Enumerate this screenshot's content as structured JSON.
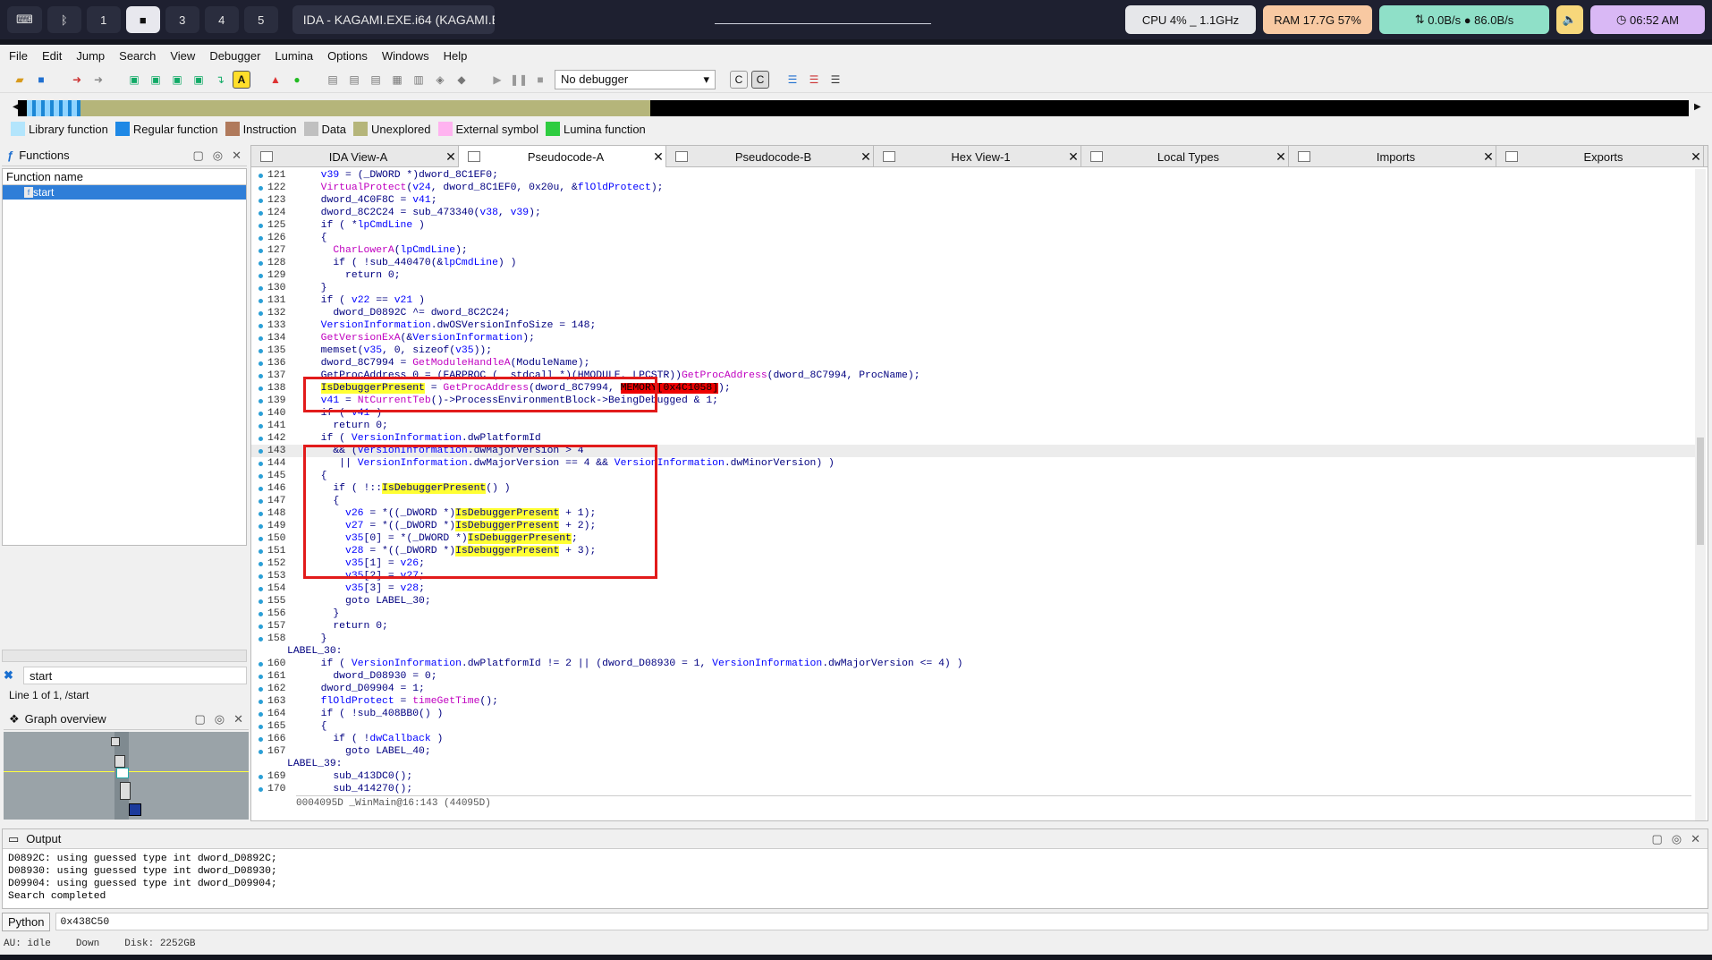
{
  "topbar": {
    "workspaces": [
      "1",
      "■",
      "3",
      "4",
      "5"
    ],
    "window_title": "IDA - KAGAMI.EXE.i64 (KAGAMI.EXE)",
    "cpu": "CPU 4% _ 1.1GHz",
    "ram": "RAM 17.7G 57%",
    "net": "0.0B/s ● 86.0B/s",
    "volume_icon": "speaker-icon",
    "clock": "06:52 AM",
    "colors": {
      "cpu": "#e6e7ea",
      "ram": "#f8c9a2",
      "net": "#8fe0c8",
      "vol": "#f7d77b",
      "clock": "#d9b8f5"
    }
  },
  "menu": [
    "File",
    "Edit",
    "Jump",
    "Search",
    "View",
    "Debugger",
    "Lumina",
    "Options",
    "Windows",
    "Help"
  ],
  "toolbar": {
    "debugger_select": "No debugger"
  },
  "legend": [
    {
      "label": "Library function",
      "color": "#b3e5fc"
    },
    {
      "label": "Regular function",
      "color": "#1e88e5"
    },
    {
      "label": "Instruction",
      "color": "#b07a5c"
    },
    {
      "label": "Data",
      "color": "#c0c0c0"
    },
    {
      "label": "Unexplored",
      "color": "#b5b57a"
    },
    {
      "label": "External symbol",
      "color": "#ffb3f0"
    },
    {
      "label": "Lumina function",
      "color": "#2ecc40"
    }
  ],
  "functions": {
    "title": "Functions",
    "header": "Function name",
    "items": [
      "start"
    ],
    "search_value": "start",
    "line_status": "Line 1 of 1, /start"
  },
  "graph": {
    "title": "Graph overview"
  },
  "tabs": [
    {
      "label": "IDA View-A",
      "active": false
    },
    {
      "label": "Pseudocode-A",
      "active": true
    },
    {
      "label": "Pseudocode-B",
      "active": false
    },
    {
      "label": "Hex View-1",
      "active": false
    },
    {
      "label": "Local Types",
      "active": false
    },
    {
      "label": "Imports",
      "active": false
    },
    {
      "label": "Exports",
      "active": false
    }
  ],
  "code_lines": [
    {
      "n": "121",
      "t": "  v39 = (_DWORD *)dword_8C1EF0;"
    },
    {
      "n": "122",
      "t": "  VirtualProtect(v24, dword_8C1EF0, 0x20u, &flOldProtect);"
    },
    {
      "n": "123",
      "t": "  dword_4C0F8C = v41;"
    },
    {
      "n": "124",
      "t": "  dword_8C2C24 = sub_473340(v38, v39);"
    },
    {
      "n": "125",
      "t": "  if ( *lpCmdLine )"
    },
    {
      "n": "126",
      "t": "  {"
    },
    {
      "n": "127",
      "t": "    CharLowerA(lpCmdLine);"
    },
    {
      "n": "128",
      "t": "    if ( !sub_440470(&lpCmdLine) )"
    },
    {
      "n": "129",
      "t": "      return 0;"
    },
    {
      "n": "130",
      "t": "  }"
    },
    {
      "n": "131",
      "t": "  if ( v22 == v21 )"
    },
    {
      "n": "132",
      "t": "    dword_D0892C ^= dword_8C2C24;"
    },
    {
      "n": "133",
      "t": "  VersionInformation.dwOSVersionInfoSize = 148;"
    },
    {
      "n": "134",
      "t": "  GetVersionExA(&VersionInformation);"
    },
    {
      "n": "135",
      "t": "  memset(v35, 0, sizeof(v35));"
    },
    {
      "n": "136",
      "t": "  dword_8C7994 = GetModuleHandleA(ModuleName);"
    },
    {
      "n": "137",
      "t": "  GetProcAddress_0 = (FARPROC (__stdcall *)(HMODULE, LPCSTR))GetProcAddress(dword_8C7994, ProcName);"
    },
    {
      "n": "138",
      "t": "  IsDebuggerPresent = GetProcAddress(dword_8C7994, MEMORY[0x4C1058]);"
    },
    {
      "n": "139",
      "t": "  v41 = NtCurrentTeb()->ProcessEnvironmentBlock->BeingDebugged & 1;"
    },
    {
      "n": "140",
      "t": "  if ( v41 )"
    },
    {
      "n": "141",
      "t": "    return 0;"
    },
    {
      "n": "142",
      "t": "  if ( VersionInformation.dwPlatformId"
    },
    {
      "n": "143",
      "t": "    && (VersionInformation.dwMajorVersion > 4"
    },
    {
      "n": "144",
      "t": "     || VersionInformation.dwMajorVersion == 4 && VersionInformation.dwMinorVersion) )"
    },
    {
      "n": "145",
      "t": "  {"
    },
    {
      "n": "146",
      "t": "    if ( !::IsDebuggerPresent() )"
    },
    {
      "n": "147",
      "t": "    {"
    },
    {
      "n": "148",
      "t": "      v26 = *((_DWORD *)IsDebuggerPresent + 1);"
    },
    {
      "n": "149",
      "t": "      v27 = *((_DWORD *)IsDebuggerPresent + 2);"
    },
    {
      "n": "150",
      "t": "      v35[0] = *(_DWORD *)IsDebuggerPresent;"
    },
    {
      "n": "151",
      "t": "      v28 = *((_DWORD *)IsDebuggerPresent + 3);"
    },
    {
      "n": "152",
      "t": "      v35[1] = v26;"
    },
    {
      "n": "153",
      "t": "      v35[2] = v27;"
    },
    {
      "n": "154",
      "t": "      v35[3] = v28;"
    },
    {
      "n": "155",
      "t": "      goto LABEL_30;"
    },
    {
      "n": "156",
      "t": "    }"
    },
    {
      "n": "157",
      "t": "    return 0;"
    },
    {
      "n": "158",
      "t": "  }"
    },
    {
      "n": "",
      "t": "LABEL_30:"
    },
    {
      "n": "160",
      "t": "  if ( VersionInformation.dwPlatformId != 2 || (dword_D08930 = 1, VersionInformation.dwMajorVersion <= 4) )"
    },
    {
      "n": "161",
      "t": "    dword_D08930 = 0;"
    },
    {
      "n": "162",
      "t": "  dword_D09904 = 1;"
    },
    {
      "n": "163",
      "t": "  flOldProtect = timeGetTime();"
    },
    {
      "n": "164",
      "t": "  if ( !sub_408BB0() )"
    },
    {
      "n": "165",
      "t": "  {"
    },
    {
      "n": "166",
      "t": "    if ( !dwCallback )"
    },
    {
      "n": "167",
      "t": "      goto LABEL_40;"
    },
    {
      "n": "",
      "t": "LABEL_39:"
    },
    {
      "n": "169",
      "t": "    sub_413DC0();"
    },
    {
      "n": "170",
      "t": "    sub_414270();"
    }
  ],
  "code_status": "0004095D _WinMain@16:143 (44095D)",
  "output": {
    "title": "Output",
    "lines": [
      "D0892C: using guessed type int dword_D0892C;",
      "D08930: using guessed type int dword_D08930;",
      "D09904: using guessed type int dword_D09904;",
      "Search completed"
    ]
  },
  "python": {
    "label": "Python",
    "value": "0x438C50"
  },
  "statusbar": [
    "AU:  idle",
    "Down",
    "Disk: 2252GB"
  ]
}
